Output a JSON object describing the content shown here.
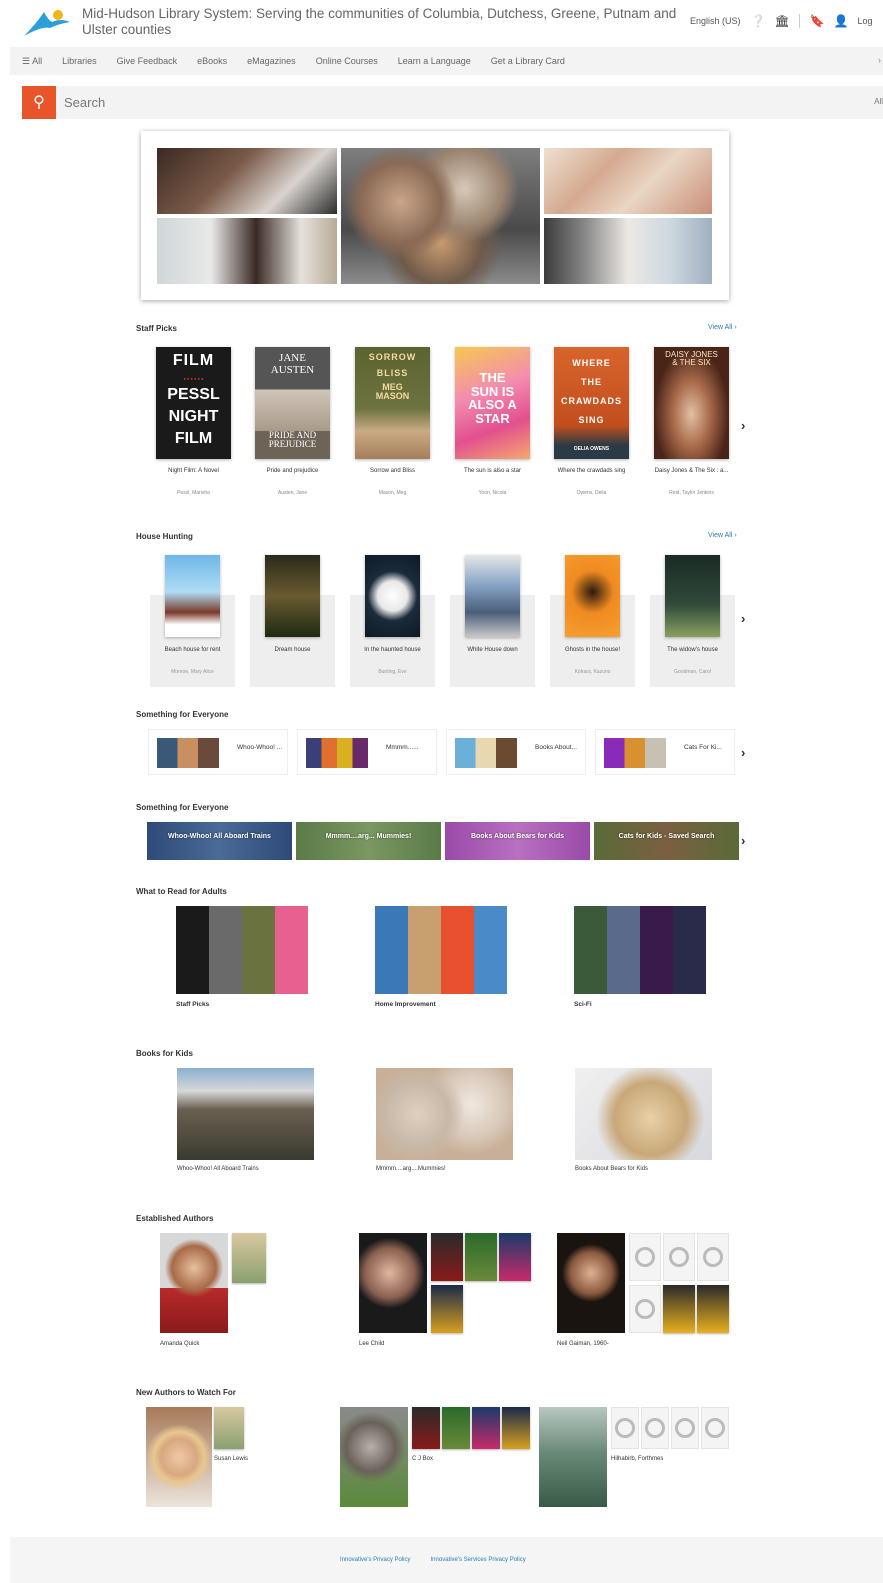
{
  "header": {
    "title": "Mid-Hudson Library System: Serving the communities of Columbia, Dutchess, Greene, Putnam and Ulster counties",
    "language": "English (US)",
    "login": "Log"
  },
  "nav": {
    "all": "☰ All",
    "items": [
      "Libraries",
      "Give Feedback",
      "eBooks",
      "eMagazines",
      "Online Courses",
      "Learn a Language",
      "Get a Library Card"
    ]
  },
  "search": {
    "placeholder": "Search",
    "scope": "All"
  },
  "staff_picks": {
    "title": "Staff Picks",
    "view_all": "View All ›",
    "books": [
      {
        "title": "Night Film: A Novel",
        "author": "Pessl, Marisha",
        "cover_text": "NIGHT FILM PESSL NIGHT FILM"
      },
      {
        "title": "Pride and prejudice",
        "author": "Austen, Jane",
        "cover_text": "JANE AUSTEN PRIDE AND PREJUDICE"
      },
      {
        "title": "Sorrow and Bliss",
        "author": "Mason, Meg",
        "cover_text": "SORROW AND BLISS MEG MASON"
      },
      {
        "title": "The sun is also a star",
        "author": "Yoon, Nicola",
        "cover_text": "THE SUN IS ALSO A STAR"
      },
      {
        "title": "Where the crawdads sing",
        "author": "Owens, Delia",
        "cover_text": "WHERE THE CRAWDADS SING DELIA OWENS"
      },
      {
        "title": "Daisy Jones & The Six : a...",
        "author": "Reid, Taylor Jenkins",
        "cover_text": "DAISY JONES & THE SIX"
      }
    ]
  },
  "house_hunting": {
    "title": "House Hunting",
    "view_all": "View All ›",
    "books": [
      {
        "title": "Beach house for rent",
        "author": "Monroe, Mary Alice"
      },
      {
        "title": "Dream house",
        "author": ""
      },
      {
        "title": "In the haunted house",
        "author": "Bunting, Eve"
      },
      {
        "title": "White House down",
        "author": ""
      },
      {
        "title": "Ghosts in the house!",
        "author": "Kohara, Kazuno"
      },
      {
        "title": "The widow's house",
        "author": "Goodman, Carol"
      }
    ]
  },
  "something_list": {
    "title": "Something for Everyone",
    "items": [
      "Whoo-Whoo! ...",
      "Mmmm......",
      "Books About...",
      "Cats For Ki..."
    ]
  },
  "something_banners": {
    "title": "Something for Everyone",
    "items": [
      "Whoo-Whoo! All Aboard Trains",
      "Mmmm....arg... Mummies!",
      "Books About Bears for Kids",
      "Cats for Kids - Saved Search"
    ]
  },
  "adults": {
    "title": "What to Read for Adults",
    "items": [
      "Staff Picks",
      "Home Improvement",
      "Sci-Fi"
    ]
  },
  "kids": {
    "title": "Books for Kids",
    "items": [
      "Whoo-Whoo! All Aboard Trains",
      "Mmmm....arg....Mummies!",
      "Books About Bears for Kids"
    ]
  },
  "established": {
    "title": "Established Authors",
    "items": [
      "Amanda Quick",
      "Lee Child",
      "Neil Gaiman, 1960-"
    ]
  },
  "new_authors": {
    "title": "New Authors to Watch For",
    "items": [
      "Susan Lewis",
      "C J Box",
      "Hilhabirb, Forthmes"
    ]
  },
  "footer": {
    "links": [
      "Innovative's Privacy Policy",
      "Innovative's Services Privacy Policy"
    ]
  },
  "colors": {
    "accent": "#e8552a",
    "link": "#2a7ab8"
  }
}
